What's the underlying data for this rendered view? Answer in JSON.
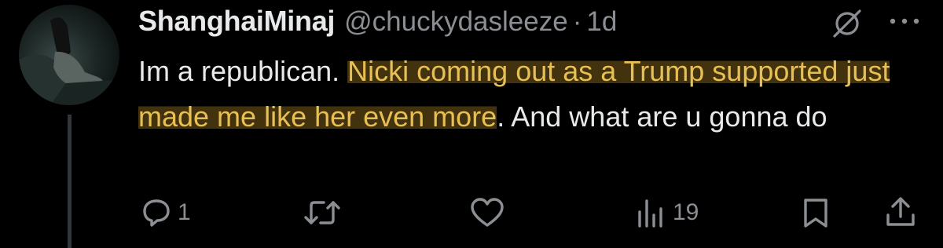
{
  "tweet": {
    "display_name": "ShanghaiMinaj",
    "handle": "@chuckydasleeze",
    "separator": "·",
    "timestamp": "1d",
    "text_before": "Im a republican. ",
    "text_highlighted": "Nicki coming out as a Trump supported just made me like her even more",
    "text_after": ". And what are u gonna do"
  },
  "actions": {
    "reply_count": "1",
    "views_count": "19"
  },
  "colors": {
    "background": "#000000",
    "text": "#e7e9ea",
    "secondary": "#8b8f94",
    "highlight_text": "#e7bf55",
    "highlight_bg": "#785c19"
  },
  "icons": [
    "grok-icon",
    "more-icon",
    "reply-icon",
    "retweet-icon",
    "like-icon",
    "views-icon",
    "bookmark-icon",
    "share-icon"
  ]
}
